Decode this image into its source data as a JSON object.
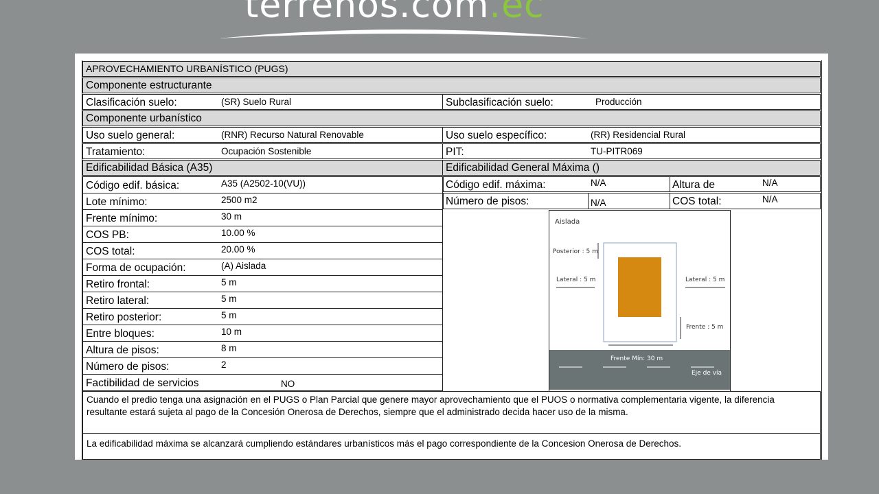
{
  "logo": {
    "main": "terrenos.com",
    "dot": ".",
    "suffix": "ec"
  },
  "colors": {
    "background": "#8b8f90",
    "header": "#d9d9d9",
    "building": "#d68910",
    "road": "#6b7474",
    "logo_accent": "#8cc63f"
  },
  "document": {
    "title": "APROVECHAMIENTO URBANÍSTICO (PUGS)",
    "estructurante": {
      "heading": "Componente  estructurante",
      "clasificacion_label": "Clasificación suelo:",
      "clasificacion_value": "(SR) Suelo Rural",
      "subclasificacion_label": "Subclasificación suelo:",
      "subclasificacion_value": "Producción"
    },
    "urbanistico": {
      "heading": "Componente  urbanístico",
      "uso_general_label": "Uso suelo general:",
      "uso_general_value": "(RNR) Recurso Natural Renovable",
      "uso_especifico_label": "Uso suelo específico:",
      "uso_especifico_value": "(RR) Residencial Rural",
      "tratamiento_label": "Tratamiento:",
      "tratamiento_value": "Ocupación Sostenible",
      "pit_label": "PIT:",
      "pit_value": "TU-PITR069"
    },
    "basica": {
      "heading": "Edificabilidad Básica (A35)",
      "rows": [
        {
          "label": "Código edif. básica:",
          "value": "A35 (A2502-10(VU))"
        },
        {
          "label": "Lote mínimo:",
          "value": "2500 m2"
        },
        {
          "label": "Frente mínimo:",
          "value": "30 m"
        },
        {
          "label": "COS PB:",
          "value": "10.00 %"
        },
        {
          "label": "COS total:",
          "value": "20.00 %"
        },
        {
          "label": "Forma de ocupación:",
          "value": "(A) Aislada"
        },
        {
          "label": "Retiro frontal:",
          "value": "5 m"
        },
        {
          "label": "Retiro lateral:",
          "value": "5 m"
        },
        {
          "label": "Retiro posterior:",
          "value": "5 m"
        },
        {
          "label": "Entre bloques:",
          "value": "10 m"
        },
        {
          "label": "Altura de pisos:",
          "value": "8 m"
        },
        {
          "label": "Número de pisos:",
          "value": "2"
        },
        {
          "label": "Factibilidad de servicios",
          "value": "NO"
        }
      ]
    },
    "maxima": {
      "heading": "Edificabilidad General Máxima ()",
      "codigo_label": "Código edif. máxima:",
      "codigo_value": "N/A",
      "altura_label": "Altura de",
      "altura_value": "N/A",
      "pisos_label": "Número de pisos:",
      "pisos_value": "N/A",
      "cos_label": "COS total:",
      "cos_value": "N/A"
    },
    "diagram": {
      "title": "Aislada",
      "posterior": "Posterior : 5 m",
      "lateral_left": "Lateral : 5 m",
      "lateral_right": "Lateral : 5 m",
      "frente": "Frente : 5 m",
      "frente_min": "Frente Mín: 30 m",
      "eje": "Eje de vía"
    },
    "note1": "Cuando el predio tenga una asignación en el PUGS o Plan Parcial que genere mayor aprovechamiento que el PUOS o normativa complementaria vigente, la diferencia resultante estará sujeta al pago de la Concesión Onerosa de Derechos, siempre que el administrado decida hacer uso de la misma.",
    "note2": "La edificabilidad máxima se alcanzará cumpliendo estándares urbanísticos más el pago correspondiente de la Concesion Onerosa de Derechos."
  }
}
